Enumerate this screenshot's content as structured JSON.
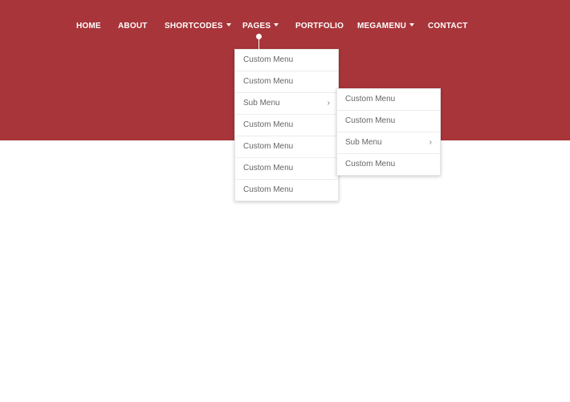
{
  "nav": {
    "items": [
      {
        "label": "HOME",
        "has_caret": false
      },
      {
        "label": "ABOUT",
        "has_caret": false
      },
      {
        "label": "SHORTCODES",
        "has_caret": true
      },
      {
        "label": "PAGES",
        "has_caret": true
      },
      {
        "label": "PORTFOLIO",
        "has_caret": false
      },
      {
        "label": "MEGAMENU",
        "has_caret": true
      },
      {
        "label": "CONTACT",
        "has_caret": false
      }
    ],
    "active": "PAGES"
  },
  "dropdown": {
    "items": [
      {
        "label": "Custom Menu"
      },
      {
        "label": "Custom Menu"
      },
      {
        "label": "Sub Menu",
        "submenu": true
      },
      {
        "label": "Custom Menu"
      },
      {
        "label": "Custom Menu"
      },
      {
        "label": "Custom Menu"
      },
      {
        "label": "Custom Menu"
      }
    ]
  },
  "submenu": {
    "items": [
      {
        "label": "Custom Menu"
      },
      {
        "label": "Custom Menu"
      },
      {
        "label": "Sub Menu",
        "submenu": true
      },
      {
        "label": "Custom Menu"
      }
    ]
  },
  "icons": {
    "caret": "caret-down-icon",
    "chevron": "chevron-right-icon"
  },
  "colors": {
    "header_bg": "#a8353a",
    "nav_text": "#ffffff",
    "menu_text": "#666666",
    "page_bg": "#ffffff"
  }
}
